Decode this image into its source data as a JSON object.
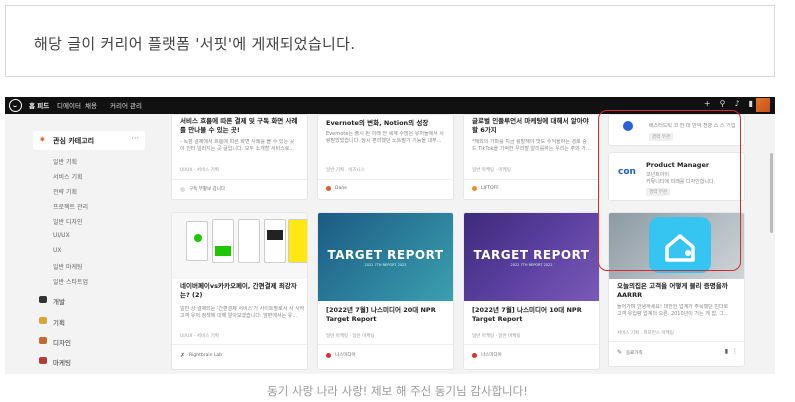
{
  "notice": {
    "text": "해당 글이 커리어 플랫폼 '서핏'에 게재되었습니다."
  },
  "caption": {
    "text": "동기 사랑 나라 사랑! 제보 해 주신 동기님 감사합니다!"
  },
  "topbar": {
    "nav": [
      "홈 피드",
      "디에이터",
      "채용",
      "커리어 관리"
    ],
    "icons": [
      "plus-icon",
      "search-icon",
      "bell-icon",
      "bookmark-icon",
      "menu-icon"
    ]
  },
  "sidebar": {
    "category_title": "관심 카테고리",
    "more": "···",
    "sub_items": [
      "일반 기획",
      "서비스 기획",
      "전략 기획",
      "프로젝트 관리",
      "일반 디자인",
      "UI/UX",
      "UX",
      "일반 마케팅",
      "일반 스타트업"
    ],
    "items": [
      {
        "label": "개발",
        "icon": "monitor-icon",
        "color": "#333333"
      },
      {
        "label": "기획",
        "icon": "note-icon",
        "color": "#d9a43a"
      },
      {
        "label": "디자인",
        "icon": "palette-icon",
        "color": "#c56a2a"
      },
      {
        "label": "마케팅",
        "icon": "megaphone-icon",
        "color": "#b53a3a"
      }
    ]
  },
  "cards": {
    "c1": {
      "title": "서비스 흐름에 따른 결제 및 구독 화면 사례를 만나볼 수 있는 곳!",
      "desc": "- 독점 결제에서 흐름에 따른 화면 사례를 볼 수 있는 곳\n이 인터 일러지는 곳 글입니다. 모두 소개할 서비스로...",
      "tags": "UI/UX · 서비스 기획",
      "author": "구독 부활보 갑니다"
    },
    "c2": {
      "title": "Evernote의 변화, Notion의 성장",
      "desc": "Evernote는 출시 된 이래 전 세계 수많은 유저들에서 사\n랑받았었습니다. 당시 편리했던 노트필기 기능을 내부...",
      "tags": "일반 기획 · 비즈니스",
      "author": "Dane"
    },
    "c3": {
      "title": "글로벌 인플루언서 마케팅에 대해서 알아야 할 6가지",
      "desc": "*해외의 가파를 지금 활발해야 맛도 수익을하는 경로 중\n드 TikTok을 기억한 우리말 알리를하는 우리는 주의 가...",
      "tags": "일반 마케팅 · 마케팅",
      "author": "LIFTOFF"
    },
    "c4": {
      "title": "네이버페이vs카카오페이, 간편결제 최강자는? (2)",
      "desc": "일반 상 결제되는 '간편결제 서비스'가 사이트별로서 시 사하\n고객 유저 정책에 대해 알아보겠습니다. 앞편에서는 유...",
      "tags": "UI/UX · 서비스 기획",
      "author": "Rightbrain Lab"
    },
    "c5": {
      "report_title": "TARGET REPORT",
      "report_sub": "2022 7TH REPORT 2022",
      "title": "[2022년 7월] 나스미디어 20대 NPR Target Report",
      "tags": "일반 마케팅 · 일반 마케팅",
      "author": "나스미디어"
    },
    "c6": {
      "report_title": "TARGET REPORT",
      "report_sub": "2022 7TH REPORT 2022",
      "title": "[2022년 7월] 나스미디어 10대 NPR Target Report",
      "tags": "일반 마케팅 · 일반 마케팅",
      "author": "나스미디어"
    },
    "c7": {
      "title": "오늘의집은 고객을 어떻게 블리 증명을까 AARRR",
      "desc": "들어가며 안녕하세요! 대한한 업계가 주목했던 빈더로\n고객 유입량 업계의 오른. 2010년이 가는 게 잡, 그...",
      "tags": "서비스 기획 · 퍼포먼스 마케팅",
      "author": "동료가족"
    },
    "job1": {
      "company": "배스터드릭 코 한 대 반약 전광 스 스 기업",
      "badge": "경력 무관"
    },
    "job2": {
      "title": "Product Manager",
      "company": "코넌트아이",
      "desc": "커뮤니티에 미래를 디자인합니다.",
      "badge": "경력 무관",
      "logo": "con"
    }
  },
  "colors": {
    "highlight": "#d92b2b",
    "accent": "#e8572a",
    "topbar": "#111111"
  }
}
